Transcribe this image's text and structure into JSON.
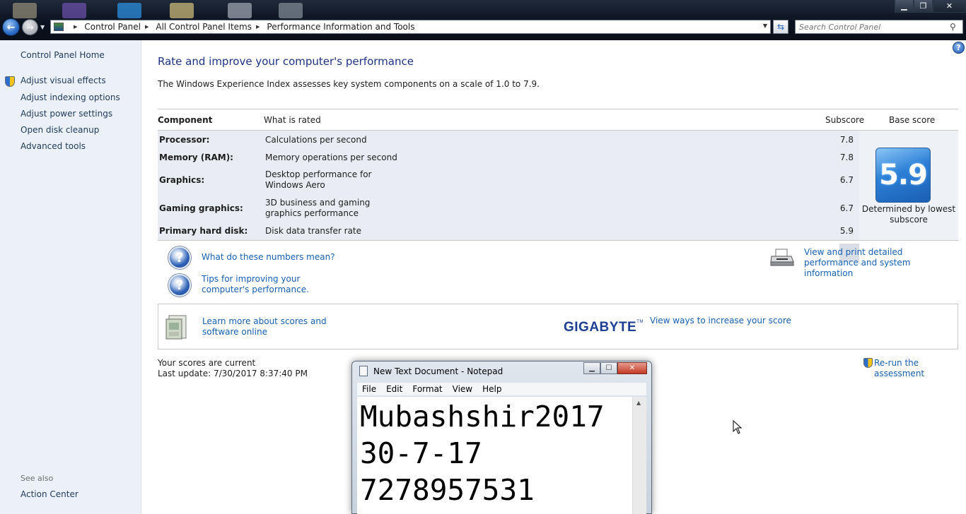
{
  "address_bar": {
    "crumbs": [
      "Control Panel",
      "All Control Panel Items",
      "Performance Information and Tools"
    ],
    "search_placeholder": "Search Control Panel"
  },
  "sidebar": {
    "home": "Control Panel Home",
    "links": [
      "Adjust visual effects",
      "Adjust indexing options",
      "Adjust power settings",
      "Open disk cleanup",
      "Advanced tools"
    ],
    "see_also_label": "See also",
    "see_also_links": [
      "Action Center"
    ]
  },
  "main": {
    "title": "Rate and improve your computer's performance",
    "subtitle": "The Windows Experience Index assesses key system components on a scale of 1.0 to 7.9.",
    "table": {
      "headers": {
        "component": "Component",
        "rated": "What is rated",
        "subscore": "Subscore",
        "base": "Base score"
      },
      "rows": [
        {
          "component": "Processor:",
          "rated": "Calculations per second",
          "subscore": "7.8"
        },
        {
          "component": "Memory (RAM):",
          "rated": "Memory operations per second",
          "subscore": "7.8"
        },
        {
          "component": "Graphics:",
          "rated": "Desktop performance for Windows Aero",
          "subscore": "6.7"
        },
        {
          "component": "Gaming graphics:",
          "rated": "3D business and gaming graphics performance",
          "subscore": "6.7"
        },
        {
          "component": "Primary hard disk:",
          "rated": "Disk data transfer rate",
          "subscore": "5.9"
        }
      ],
      "base_score": "5.9",
      "base_note": "Determined by lowest subscore"
    },
    "links": {
      "numbers_meaning": "What do these numbers mean?",
      "tips": "Tips for improving your computer's performance.",
      "view_print": "View and print detailed performance and system information",
      "learn_more": "Learn more about scores and software online",
      "increase_score": "View ways to increase your score",
      "rerun": "Re-run the assessment"
    },
    "brand": "GIGABYTE",
    "brand_tm": "TM",
    "status": {
      "current": "Your scores are current",
      "last_update": "Last update: 7/30/2017 8:37:40 PM"
    }
  },
  "notepad": {
    "title": "New Text Document - Notepad",
    "menu": [
      "File",
      "Edit",
      "Format",
      "View",
      "Help"
    ],
    "lines": [
      "Mubashshir2017",
      "30-7-17",
      "7278957531"
    ]
  },
  "colors": {
    "link": "#1660b4",
    "title": "#1e3287",
    "sidebar_bg": "#ecf1f9",
    "table_bg": "#e9ecf2"
  }
}
